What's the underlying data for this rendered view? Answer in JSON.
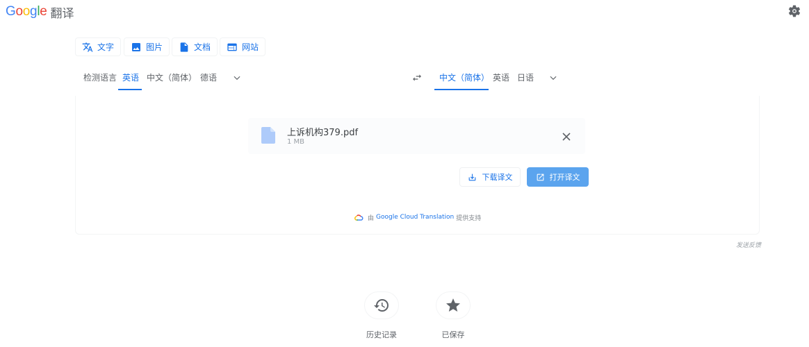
{
  "header": {
    "logo_letters": [
      "G",
      "o",
      "o",
      "g",
      "l",
      "e"
    ],
    "logo_colors": [
      "#4285f4",
      "#ea4335",
      "#fbbc05",
      "#4285f4",
      "#34a853",
      "#ea4335"
    ],
    "product_name": "翻译"
  },
  "modes": [
    {
      "label": "文字",
      "icon": "translate-icon"
    },
    {
      "label": "图片",
      "icon": "image-icon"
    },
    {
      "label": "文档",
      "icon": "document-icon"
    },
    {
      "label": "网站",
      "icon": "website-icon"
    }
  ],
  "source_langs": [
    "检测语言",
    "英语",
    "中文（简体）",
    "德语"
  ],
  "source_active": "英语",
  "target_langs": [
    "中文（简体）",
    "英语",
    "日语"
  ],
  "target_active": "中文（简体）",
  "file": {
    "name": "上诉机构379.pdf",
    "size": "1 MB"
  },
  "actions": {
    "download": "下载译文",
    "open": "打开译文"
  },
  "powered_by": {
    "prefix": "由",
    "brand": "Google Cloud Translation",
    "suffix": "提供支持"
  },
  "feedback": "发送反馈",
  "bottom": {
    "history": "历史记录",
    "saved": "已保存"
  },
  "colors": {
    "accent": "#1a73e8",
    "primary_button": "#5ba4ee"
  }
}
